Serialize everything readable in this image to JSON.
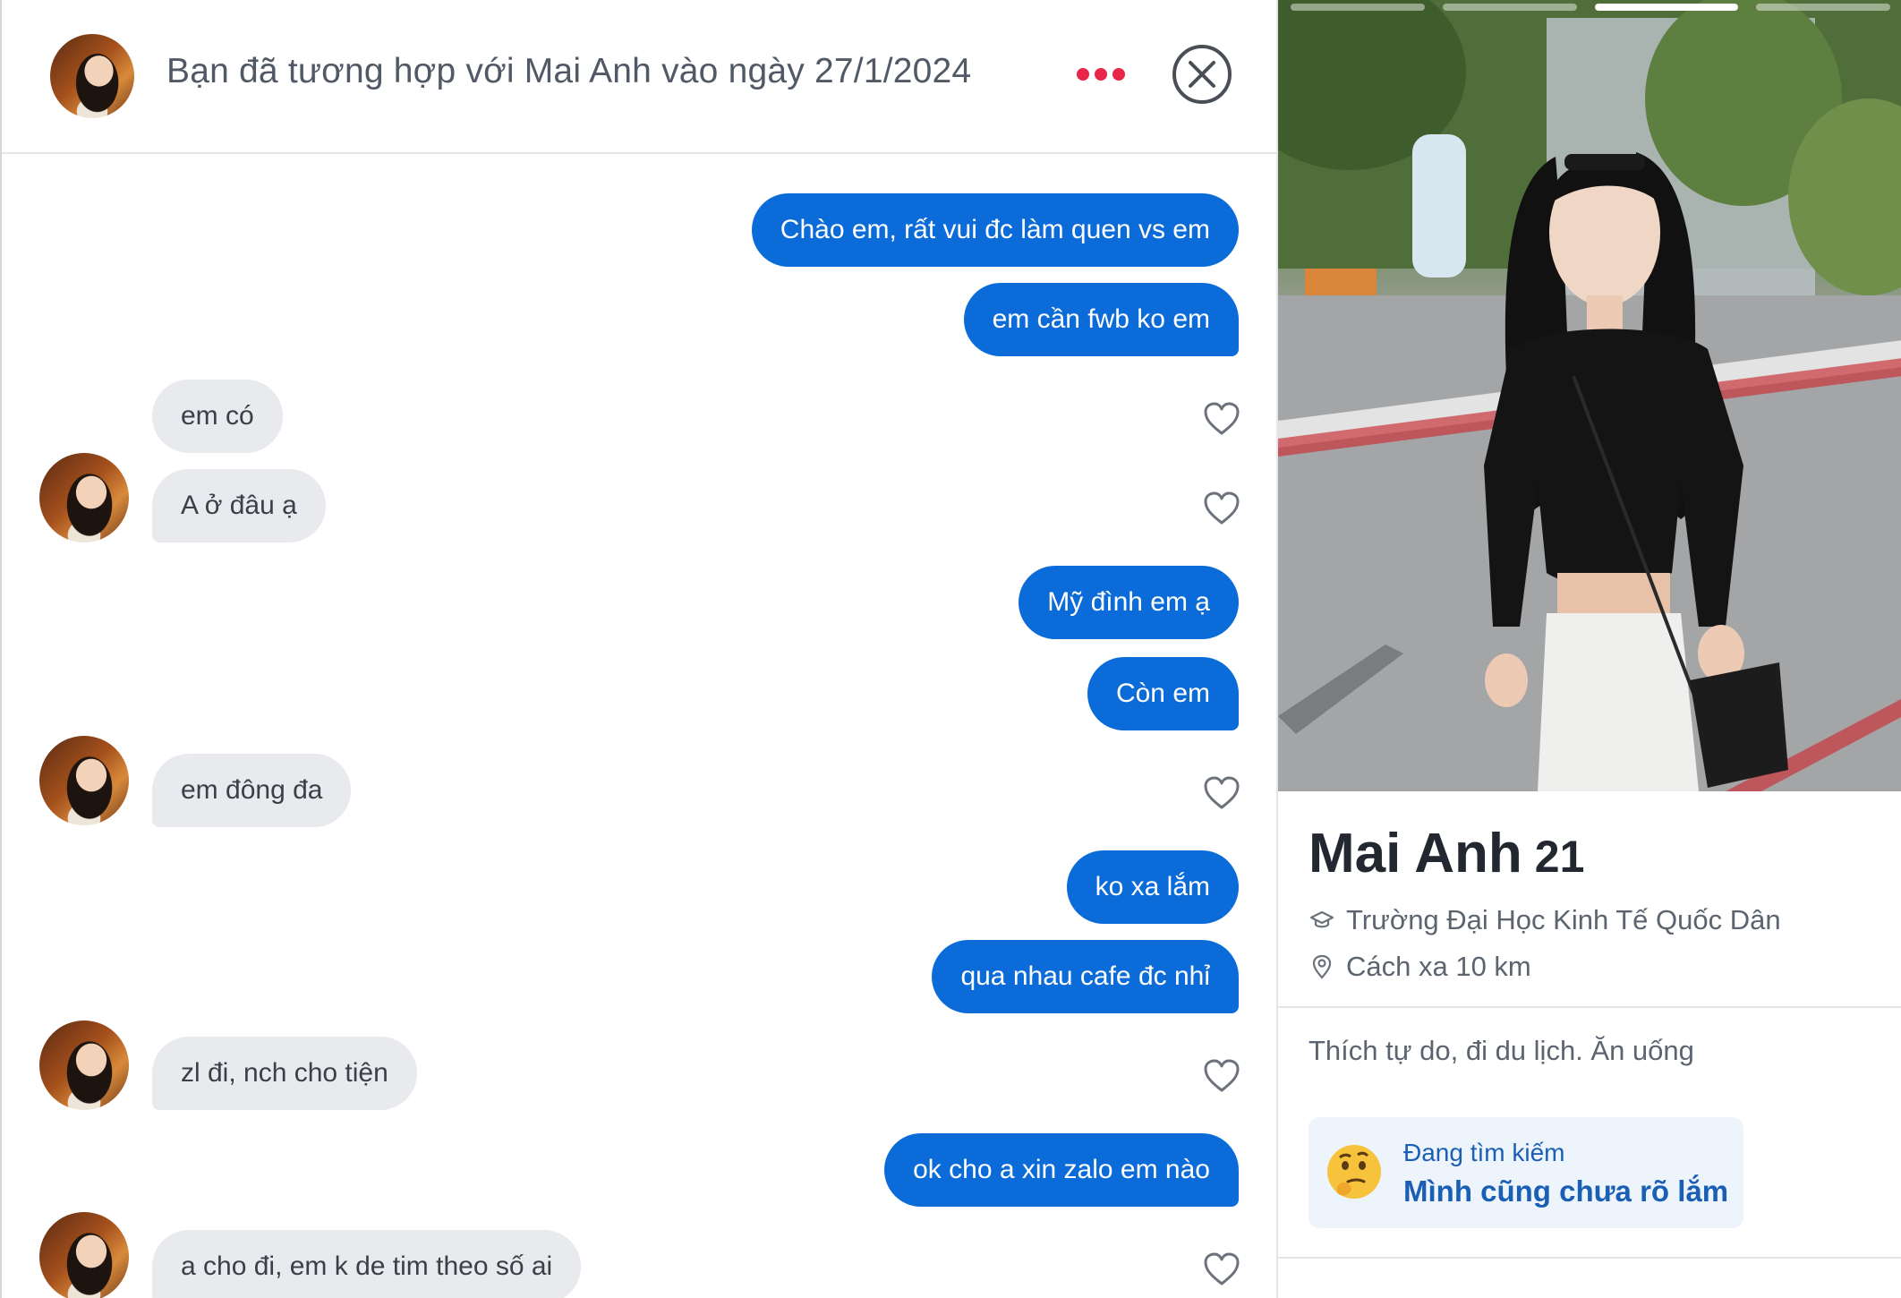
{
  "header": {
    "title": "Bạn đã tương hợp với Mai Anh vào ngày 27/1/2024",
    "more_icon": "more-dots-icon",
    "close_icon": "close-circle-icon"
  },
  "messages": [
    {
      "side": "sent",
      "text": "Chào em, rất vui đc làm quen vs em"
    },
    {
      "side": "sent",
      "text": "em cần fwb ko em"
    },
    {
      "side": "received",
      "text": "em có"
    },
    {
      "side": "received",
      "text": "A ở đâu ạ"
    },
    {
      "side": "sent",
      "text": "Mỹ đình em ạ"
    },
    {
      "side": "sent",
      "text": "Còn em"
    },
    {
      "side": "received",
      "text": "em đông đa"
    },
    {
      "side": "sent",
      "text": "ko xa lắm"
    },
    {
      "side": "sent",
      "text": "qua nhau cafe đc nhỉ"
    },
    {
      "side": "received",
      "text": "zl đi, nch cho tiện"
    },
    {
      "side": "sent",
      "text": "ok cho a xin zalo em nào"
    },
    {
      "side": "received",
      "text": "a cho đi, em k de tim theo số ai"
    }
  ],
  "profile": {
    "name": "Mai Anh",
    "age": "21",
    "school": "Trường Đại Học Kinh Tế Quốc Dân",
    "distance": "Cách xa 10 km",
    "bio": "Thích tự do, đi du lịch. Ăn uống",
    "looking_for_label": "Đang tìm kiếm",
    "looking_for_value": "Mình cũng chưa rõ lắm",
    "photo_count": 4,
    "active_photo": 3
  },
  "colors": {
    "sent_bubble": "#0b6bd8",
    "received_bubble": "#e9eaed",
    "accent_red": "#e8264a",
    "link_blue": "#1a5fb4"
  }
}
